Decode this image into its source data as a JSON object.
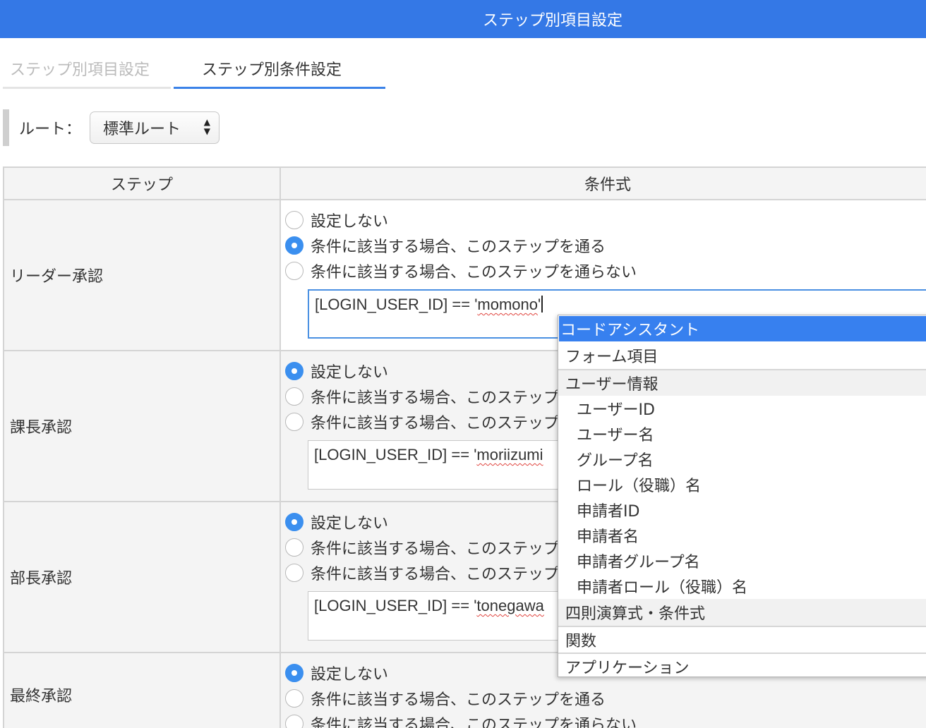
{
  "header": {
    "title": "ステップ別項目設定"
  },
  "tabs": [
    {
      "label": "ステップ別項目設定"
    },
    {
      "label": "ステップ別条件設定"
    }
  ],
  "route": {
    "label": "ルート：",
    "selected": "標準ルート"
  },
  "table": {
    "headers": {
      "step": "ステップ",
      "expression": "条件式"
    },
    "options": {
      "none": "設定しない",
      "pass": "条件に該当する場合、このステップを通る",
      "skip": "条件に該当する場合、このステップを通らない"
    },
    "rows": [
      {
        "step": "リーダー承認",
        "selected": "pass",
        "expr_prefix": "[LOGIN_USER_ID] == '",
        "expr_value": "momono",
        "expr_suffix": "'"
      },
      {
        "step": "課長承認",
        "selected": "none",
        "expr_prefix": "[LOGIN_USER_ID] == '",
        "expr_value": "moriizumi",
        "expr_suffix": ""
      },
      {
        "step": "部長承認",
        "selected": "none",
        "expr_prefix": "[LOGIN_USER_ID] == '",
        "expr_value": "tonegawa",
        "expr_suffix": ""
      },
      {
        "step": "最終承認",
        "selected": "none"
      }
    ]
  },
  "assistant": {
    "title": "コードアシスタント",
    "categories": {
      "form": "フォーム項目",
      "user": "ユーザー情報",
      "arith": "四則演算式・条件式",
      "func": "関数",
      "app": "アプリケーション"
    },
    "user_items": [
      "ユーザーID",
      "ユーザー名",
      "グループ名",
      "ロール（役職）名",
      "申請者ID",
      "申請者名",
      "申請者グループ名",
      "申請者ロール（役職）名"
    ]
  }
}
